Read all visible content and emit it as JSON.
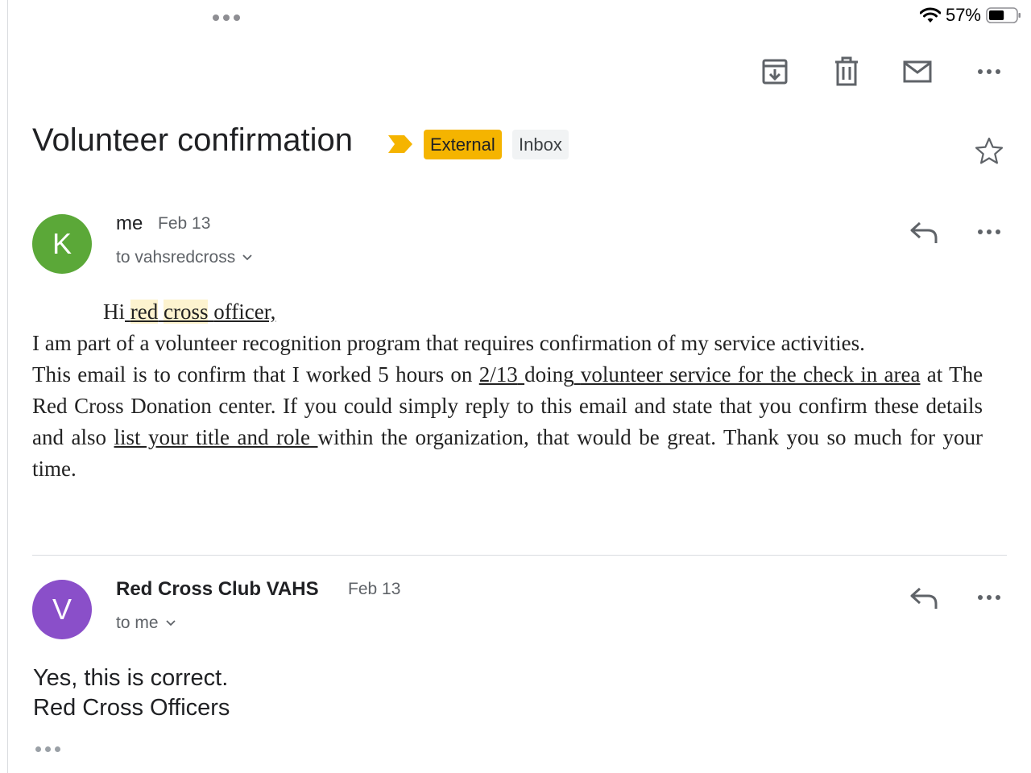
{
  "status_bar": {
    "battery_percent": "57%",
    "battery_level": 0.57
  },
  "toolbar": {
    "archive_icon": "archive-icon",
    "delete_icon": "trash-icon",
    "mark_unread_icon": "mail-icon",
    "more_icon": "more-horiz-icon"
  },
  "thread": {
    "subject": "Volunteer confirmation",
    "labels": [
      "External",
      "Inbox"
    ],
    "label_colors": {
      "External": "#f5b400",
      "Inbox": "#f1f3f4"
    },
    "importance_color": "#f5b400"
  },
  "messages": [
    {
      "avatar_letter": "K",
      "avatar_color": "#5ba838",
      "sender": "me",
      "date": "Feb 13",
      "recipients": "to vahsredcross",
      "body": {
        "greeting_prefix": "Hi",
        "greeting_red": "red",
        "greeting_cross": "cross",
        "greeting_officer": "officer,",
        "line1": "I am part of a volunteer recognition program that requires confirmation of my service activities.",
        "s1": "This email is to confirm that I worked 5",
        "s2": "hours on",
        "date_value": "2/13",
        "s3": "doing",
        "activity": "volunteer service for the check in area",
        "s4": "at The Red Cross Donation center",
        "s5": ". If you could simply reply to this email and state that you confirm these details and also",
        "request": "list your title and role",
        "s6": "within the organization, that would be great. Thank you so much for your time."
      }
    },
    {
      "avatar_letter": "V",
      "avatar_color": "#8a4fc9",
      "sender": "Red Cross Club VAHS",
      "date": "Feb 13",
      "recipients": "to me",
      "body_line1": "Yes, this is correct.",
      "body_line2": "Red Cross Officers"
    }
  ]
}
